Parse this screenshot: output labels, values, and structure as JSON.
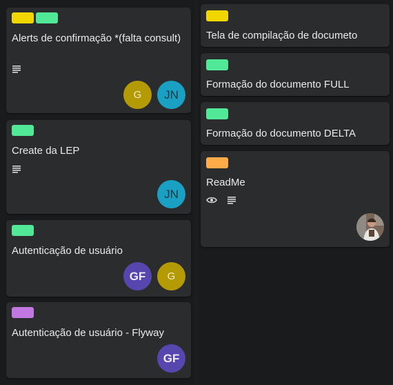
{
  "colors": {
    "yellow": "#f2d600",
    "green": "#51e898",
    "purple": "#c377e0",
    "orange": "#ffab4a"
  },
  "left_list": {
    "cards": [
      {
        "title": "Alerts de confirmação *(falta consult)",
        "labels": [
          "yellow",
          "green"
        ],
        "badges": [
          "description-icon"
        ],
        "members": [
          "G",
          "JN"
        ]
      },
      {
        "title": "Create da LEP",
        "labels": [
          "green"
        ],
        "badges": [
          "description-icon"
        ],
        "members": [
          "JN"
        ]
      },
      {
        "title": "Autenticação de usuário",
        "labels": [
          "green"
        ],
        "badges": [],
        "members": [
          "GF",
          "G"
        ]
      },
      {
        "title": "Autenticação de usuário - Flyway",
        "labels": [
          "purple"
        ],
        "badges": [],
        "members": [
          "GF"
        ]
      }
    ]
  },
  "right_list": {
    "cards": [
      {
        "title": "Tela de compilação de documeto",
        "labels": [
          "yellow"
        ],
        "badges": [],
        "members": []
      },
      {
        "title": "Formação do documento FULL",
        "labels": [
          "green"
        ],
        "badges": [],
        "members": []
      },
      {
        "title": "Formação do documento DELTA",
        "labels": [
          "green"
        ],
        "badges": [],
        "members": []
      },
      {
        "title": "ReadMe",
        "labels": [
          "orange"
        ],
        "badges": [
          "eye-icon",
          "description-icon"
        ],
        "members": [
          "photo-avatar"
        ]
      }
    ]
  }
}
